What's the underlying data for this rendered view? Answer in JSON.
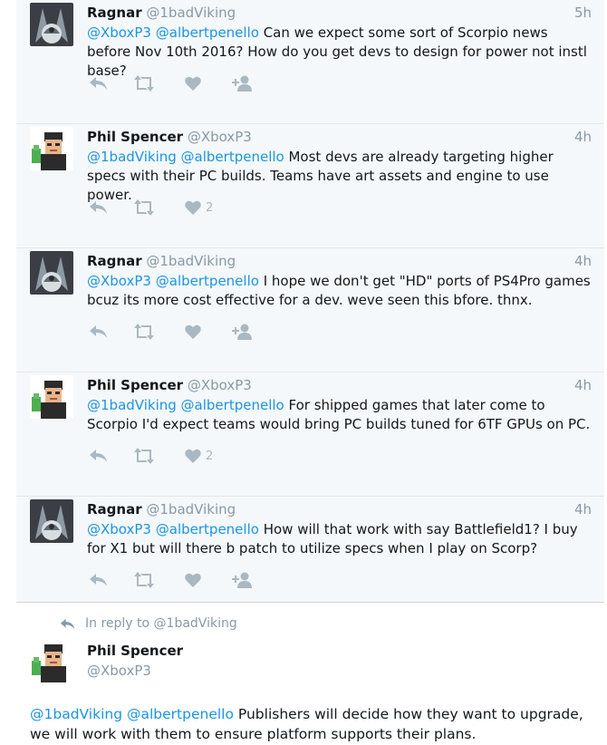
{
  "conversation": [
    {
      "author_name": "Ragnar",
      "author_handle": "@1badViking",
      "time": "5h",
      "mentions": [
        "@XboxP3",
        "@albertpenello"
      ],
      "text": "Can we expect some sort of Scorpio news before Nov 10th 2016? How do you get devs to design for power not instl base?",
      "like_count": "",
      "avatar": "viking-avatar",
      "action_icons": [
        "reply-icon",
        "retweet-icon",
        "heart-icon",
        "follow-icon"
      ]
    },
    {
      "author_name": "Phil Spencer",
      "author_handle": "@XboxP3",
      "time": "4h",
      "mentions": [
        "@1badViking",
        "@albertpenello"
      ],
      "text": "Most devs are already targeting higher specs with their PC builds. Teams have art assets and engine to use power.",
      "like_count": "2",
      "avatar": "phil-avatar",
      "action_icons": [
        "reply-icon",
        "retweet-icon",
        "heart-icon"
      ]
    },
    {
      "author_name": "Ragnar",
      "author_handle": "@1badViking",
      "time": "4h",
      "mentions": [
        "@XboxP3",
        "@albertpenello"
      ],
      "text": "I hope we don't get \"HD\" ports of PS4Pro games bcuz its more cost effective for a dev. weve seen this bfore. thnx.",
      "like_count": "",
      "avatar": "viking-avatar",
      "action_icons": [
        "reply-icon",
        "retweet-icon",
        "heart-icon",
        "follow-icon"
      ]
    },
    {
      "author_name": "Phil Spencer",
      "author_handle": "@XboxP3",
      "time": "4h",
      "mentions": [
        "@1badViking",
        "@albertpenello"
      ],
      "text": "For shipped games that later come to Scorpio I'd expect teams would bring PC builds tuned for 6TF GPUs on PC.",
      "like_count": "2",
      "avatar": "phil-avatar",
      "action_icons": [
        "reply-icon",
        "retweet-icon",
        "heart-icon"
      ]
    },
    {
      "author_name": "Ragnar",
      "author_handle": "@1badViking",
      "time": "4h",
      "mentions": [
        "@XboxP3",
        "@albertpenello"
      ],
      "text": "How will that work with say Battlefield1? I buy for X1 but will there b patch to utilize specs when I play on Scorp?",
      "like_count": "",
      "avatar": "viking-avatar",
      "action_icons": [
        "reply-icon",
        "retweet-icon",
        "heart-icon",
        "follow-icon"
      ]
    }
  ],
  "main_tweet": {
    "reply_prefix": "In reply to",
    "reply_to": "@1badViking",
    "author_name": "Phil Spencer",
    "author_handle": "@XboxP3",
    "mentions": [
      "@1badViking",
      "@albertpenello"
    ],
    "text": "Publishers will decide how they want to upgrade, we will work with them to ensure platform supports their plans.",
    "avatar": "phil-avatar"
  },
  "colors": {
    "link": "#1b95e0",
    "secondary_text": "#8899a6",
    "action_icon": "#aab8c2",
    "thread_background": "#f5f8fa"
  }
}
